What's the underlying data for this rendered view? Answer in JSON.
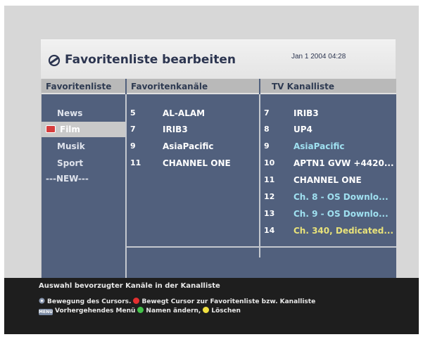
{
  "header": {
    "title": "Favoritenliste bearbeiten",
    "datetime": "Jan 1 2004 04:28",
    "icon": "remote-control-icon"
  },
  "columns": {
    "favorites": "Favoritenliste",
    "favorite_channels": "Favoritenkanäle",
    "tv_channels": "TV Kanalliste"
  },
  "favorites": [
    {
      "label": "News"
    },
    {
      "label": "Film",
      "selected": true
    },
    {
      "label": "Musik"
    },
    {
      "label": "Sport"
    },
    {
      "label": "---NEW---"
    }
  ],
  "favorite_channels": [
    {
      "num": "5",
      "name": "AL-ALAM"
    },
    {
      "num": "7",
      "name": "IRIB3"
    },
    {
      "num": "9",
      "name": "AsiaPacific"
    },
    {
      "num": "11",
      "name": "CHANNEL ONE"
    }
  ],
  "tv_channels": [
    {
      "num": "7",
      "name": "IRIB3",
      "color": "#ffffff"
    },
    {
      "num": "8",
      "name": "UP4",
      "color": "#ffffff"
    },
    {
      "num": "9",
      "name": "AsiaPacific",
      "color": "#9fe0f0"
    },
    {
      "num": "10",
      "name": "APTN1 GVW +4420...",
      "color": "#ffffff"
    },
    {
      "num": "11",
      "name": "CHANNEL ONE",
      "color": "#ffffff"
    },
    {
      "num": "12",
      "name": "Ch. 8 - OS Downlo...",
      "color": "#9fe0f0"
    },
    {
      "num": "13",
      "name": "Ch. 9 - OS Downlo...",
      "color": "#9fe0f0"
    },
    {
      "num": "14",
      "name": "Ch. 340, Dedicated...",
      "color": "#e8e27a"
    }
  ],
  "footer": {
    "description": "Auswahl bevorzugter Kanäle in der Kanalliste",
    "hint_cursor": "Bewegung des Cursors.",
    "hint_red": "Bewegt Cursor zur Favoritenliste bzw. Kanalliste",
    "menu_key_label": "MENU",
    "hint_menu": "Vorhergehendes Menü",
    "hint_green": "Namen ändern,",
    "hint_yellow": "Löschen"
  },
  "colors": {
    "panel": "#51607d",
    "header_bar": "#b9b9b9",
    "red_key": "#e23030",
    "green_key": "#44c24a",
    "yellow_key": "#f0e040"
  }
}
